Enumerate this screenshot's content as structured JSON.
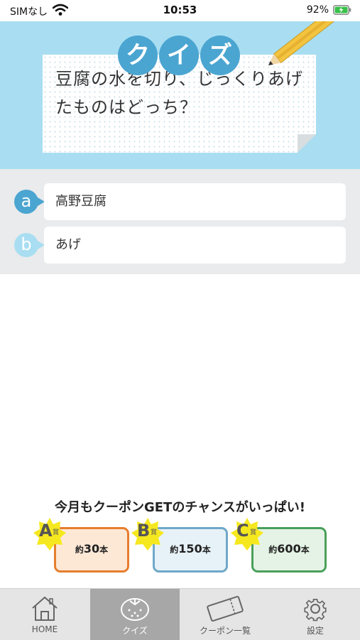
{
  "status_bar": {
    "carrier": "SIMなし",
    "time": "10:53",
    "battery": "92%"
  },
  "quiz": {
    "title_chars": [
      "ク",
      "イ",
      "ズ"
    ],
    "question": "豆腐の水を切り、じっくりあげたものはどっち？"
  },
  "answers": [
    {
      "bullet": "a",
      "label": "高野豆腐"
    },
    {
      "bullet": "b",
      "label": "あげ"
    }
  ],
  "campaign": {
    "title": "今月もクーポンGETのチャンスがいっぱい!",
    "prizes": [
      {
        "letter": "A",
        "sho": "賞",
        "prefix": "約",
        "count": "30",
        "unit": "本",
        "border": "#e67e2e",
        "fill": "#fde8d6"
      },
      {
        "letter": "B",
        "sho": "賞",
        "prefix": "約",
        "count": "150",
        "unit": "本",
        "border": "#6fa8c8",
        "fill": "#e7f2f8"
      },
      {
        "letter": "C",
        "sho": "賞",
        "prefix": "約",
        "count": "600",
        "unit": "本",
        "border": "#4aa05a",
        "fill": "#e5f3e6"
      }
    ]
  },
  "tabs": [
    {
      "label": "HOME",
      "icon": "home-icon"
    },
    {
      "label": "クイズ",
      "icon": "quiz-icon"
    },
    {
      "label": "クーポン一覧",
      "icon": "coupon-icon"
    },
    {
      "label": "設定",
      "icon": "gear-icon"
    }
  ],
  "colors": {
    "accent": "#4ba5d1",
    "quiz_bg": "#a9def2",
    "tab_active": "#a7a7a7"
  }
}
